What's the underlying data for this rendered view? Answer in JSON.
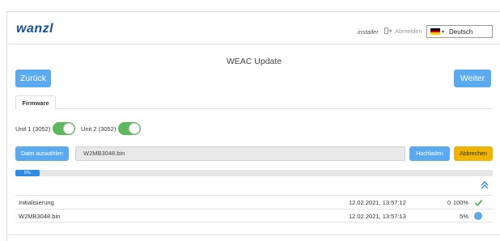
{
  "header": {
    "logo": "wanzl",
    "user": "installer",
    "logout_label": "Abmelden",
    "language": "Deutsch"
  },
  "page": {
    "title": "WEAC Update",
    "back_label": "Zurück",
    "next_label": "Weiter"
  },
  "tabs": [
    {
      "label": "Firmware"
    }
  ],
  "units": [
    {
      "label": "Unit 1 (3052)",
      "enabled": true
    },
    {
      "label": "Unit 2 (3052)",
      "enabled": true
    }
  ],
  "upload": {
    "select_label": "Datei auswählen",
    "file_name": "W2MB3048.bin",
    "upload_label": "Hochladen",
    "cancel_label": "Abbrechen"
  },
  "progress": {
    "value_percent": 5,
    "label": "5%"
  },
  "log": [
    {
      "name": "Initialisierung",
      "time": "12.02.2021, 13:57:12",
      "count": "0",
      "percent": "100%",
      "status": "done"
    },
    {
      "name": "W2MB3048.bin",
      "time": "12.02.2021, 13:57:13",
      "count": "",
      "percent": "5%",
      "status": "running"
    }
  ],
  "colors": {
    "primary": "#5aaaf0",
    "progress": "#2d8ce8",
    "success": "#5cb85c",
    "warning": "#f0b400",
    "logo": "#1a4f94"
  },
  "icons": {
    "logout": "logout-icon",
    "collapse": "chevron-double-up-icon",
    "done": "checkmark-icon",
    "running": "status-dot-icon"
  }
}
